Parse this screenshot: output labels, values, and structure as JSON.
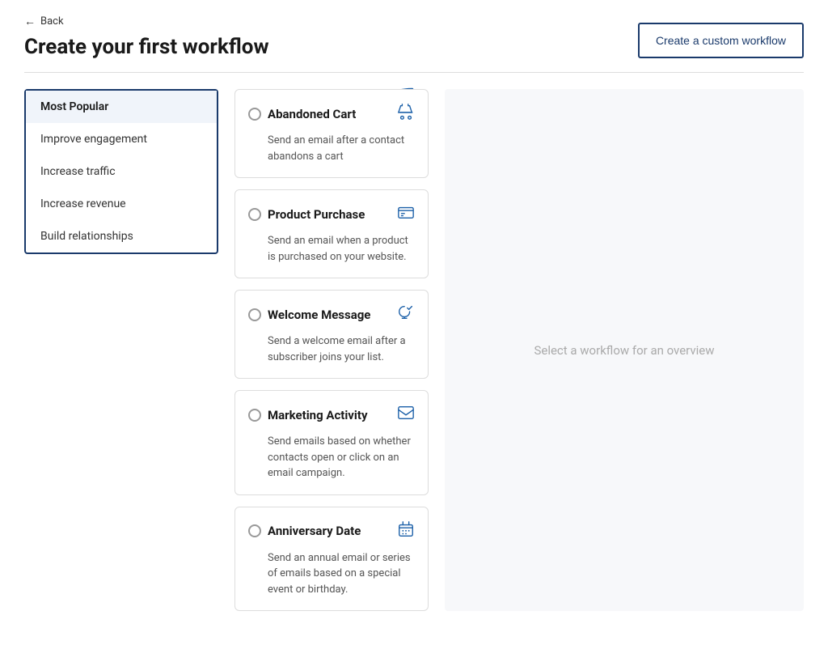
{
  "back": {
    "label": "Back"
  },
  "page": {
    "title": "Create your first workflow"
  },
  "header": {
    "custom_btn_label": "Create a custom workflow"
  },
  "sidebar": {
    "items": [
      {
        "id": "most-popular",
        "label": "Most Popular",
        "active": true
      },
      {
        "id": "improve-engagement",
        "label": "Improve engagement",
        "active": false
      },
      {
        "id": "increase-traffic",
        "label": "Increase traffic",
        "active": false
      },
      {
        "id": "increase-revenue",
        "label": "Increase revenue",
        "active": false
      },
      {
        "id": "build-relationships",
        "label": "Build relationships",
        "active": false
      }
    ]
  },
  "workflows": [
    {
      "id": "abandoned-cart",
      "title": "Abandoned Cart",
      "description": "Send an email after a contact abandons a cart",
      "icon": "🛒"
    },
    {
      "id": "product-purchase",
      "title": "Product Purchase",
      "description": "Send an email when a product is purchased on your website.",
      "icon": "💳"
    },
    {
      "id": "welcome-message",
      "title": "Welcome Message",
      "description": "Send a welcome email after a subscriber joins your list.",
      "icon": "🤝"
    },
    {
      "id": "marketing-activity",
      "title": "Marketing Activity",
      "description": "Send emails based on whether contacts open or click on an email campaign.",
      "icon": "✉️"
    },
    {
      "id": "anniversary-date",
      "title": "Anniversary Date",
      "description": "Send an annual email or series of emails based on a special event or birthday.",
      "icon": "🎂"
    }
  ],
  "overview": {
    "placeholder": "Select a workflow for an overview"
  }
}
